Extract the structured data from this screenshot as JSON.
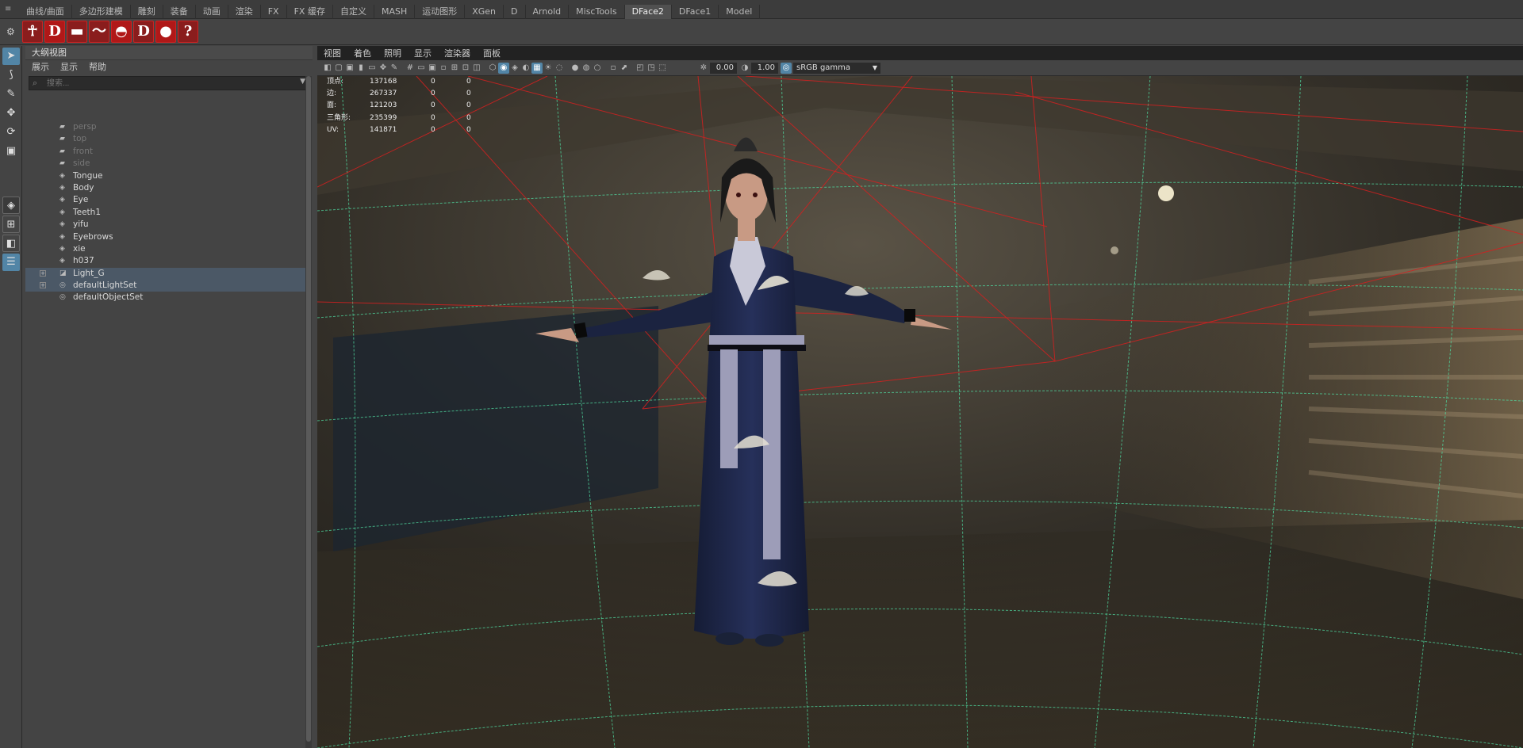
{
  "shelf": {
    "tabs": [
      "曲线/曲面",
      "多边形建模",
      "雕刻",
      "装备",
      "动画",
      "渲染",
      "FX",
      "FX 缓存",
      "自定义",
      "MASH",
      "运动图形",
      "XGen",
      "D",
      "Arnold",
      "MiscTools",
      "DFace2",
      "DFace1",
      "Model"
    ],
    "active_tab": "DFace2",
    "icons": [
      "D",
      "D",
      "D",
      "D",
      "D",
      "D",
      "?"
    ]
  },
  "outliner": {
    "title": "大纲视图",
    "menu": [
      "展示",
      "显示",
      "帮助"
    ],
    "search_placeholder": "搜索...",
    "items": [
      {
        "label": "persp",
        "icon": "camera-icon",
        "dim": true
      },
      {
        "label": "top",
        "icon": "camera-icon",
        "dim": true
      },
      {
        "label": "front",
        "icon": "camera-icon",
        "dim": true
      },
      {
        "label": "side",
        "icon": "camera-icon",
        "dim": true
      },
      {
        "label": "Tongue",
        "icon": "mesh-icon",
        "dim": false
      },
      {
        "label": "Body",
        "icon": "mesh-icon",
        "dim": false
      },
      {
        "label": "Eye",
        "icon": "mesh-icon",
        "dim": false
      },
      {
        "label": "Teeth1",
        "icon": "mesh-icon",
        "dim": false
      },
      {
        "label": "yifu",
        "icon": "mesh-icon",
        "dim": false
      },
      {
        "label": "Eyebrows",
        "icon": "mesh-icon",
        "dim": false
      },
      {
        "label": "xie",
        "icon": "mesh-icon",
        "dim": false
      },
      {
        "label": "h037",
        "icon": "mesh-icon",
        "dim": false
      },
      {
        "label": "Light_G",
        "icon": "light-group-icon",
        "dim": false,
        "expandable": true,
        "selected": true
      },
      {
        "label": "defaultLightSet",
        "icon": "set-icon",
        "dim": false,
        "expandable": true,
        "selected": true
      },
      {
        "label": "defaultObjectSet",
        "icon": "set-icon",
        "dim": false
      }
    ]
  },
  "viewport": {
    "menu": [
      "视图",
      "着色",
      "照明",
      "显示",
      "渲染器",
      "面板"
    ],
    "exposure": "0.00",
    "gamma": "1.00",
    "color_space": "sRGB gamma",
    "hud": [
      {
        "label": "顶点:",
        "v1": "137168",
        "v2": "0",
        "v3": "0"
      },
      {
        "label": "边:",
        "v1": "267337",
        "v2": "0",
        "v3": "0"
      },
      {
        "label": "面:",
        "v1": "121203",
        "v2": "0",
        "v3": "0"
      },
      {
        "label": "三角形:",
        "v1": "235399",
        "v2": "0",
        "v3": "0"
      },
      {
        "label": "UV:",
        "v1": "141871",
        "v2": "0",
        "v3": "0"
      }
    ]
  },
  "colors": {
    "accent": "#5285a6",
    "selection": "#4b5866",
    "grid": "#4fd9a0",
    "light_lines": "#d42020",
    "robe": "#1d2544"
  }
}
